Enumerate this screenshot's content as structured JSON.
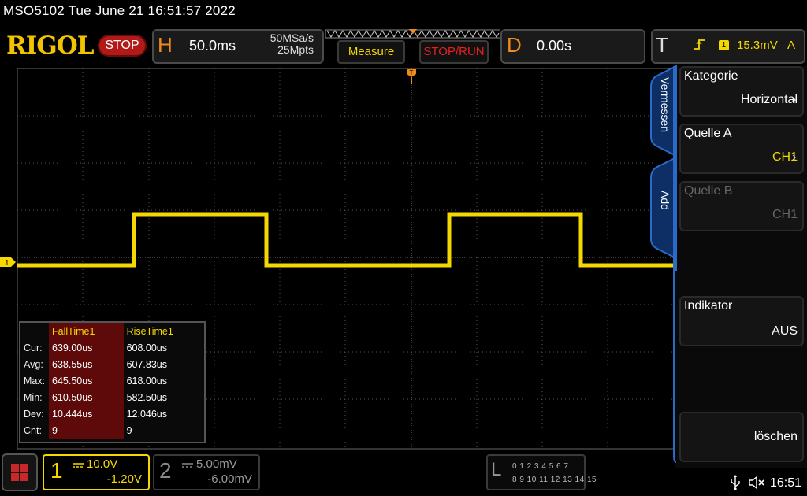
{
  "title": "MSO5102  Tue June 21 16:51:57 2022",
  "logo": "RIGOL",
  "status": "STOP",
  "horizontal": {
    "letter": "H",
    "timebase": "50.0ms",
    "sample_rate": "50MSa/s",
    "memory_depth": "25Mpts"
  },
  "buttons": {
    "measure": "Measure",
    "stop_run": "STOP/RUN"
  },
  "delay": {
    "letter": "D",
    "value": "0.00s"
  },
  "trigger": {
    "letter": "T",
    "source_num": "1",
    "level": "15.3mV",
    "mode": "A"
  },
  "side_tabs": {
    "measure": "Vermessen",
    "add": "Add"
  },
  "side_menu": {
    "category": {
      "label": "Kategorie",
      "value": "Horizontal"
    },
    "source_a": {
      "label": "Quelle A",
      "value": "CH1"
    },
    "source_b": {
      "label": "Quelle B",
      "value": "CH1"
    },
    "indicator": {
      "label": "Indikator",
      "value": "AUS"
    },
    "clear": {
      "label": "löschen"
    }
  },
  "measurements": {
    "headers": [
      "FallTime1",
      "RiseTime1"
    ],
    "rows": [
      {
        "label": "Cur:",
        "fall": "639.00us",
        "rise": "608.00us"
      },
      {
        "label": "Avg:",
        "fall": "638.55us",
        "rise": "607.83us"
      },
      {
        "label": "Max:",
        "fall": "645.50us",
        "rise": "618.00us"
      },
      {
        "label": "Min:",
        "fall": "610.50us",
        "rise": "582.50us"
      },
      {
        "label": "Dev:",
        "fall": "10.444us",
        "rise": "12.046us"
      },
      {
        "label": "Cnt:",
        "fall": "9",
        "rise": "9"
      }
    ]
  },
  "channel1": {
    "number": "1",
    "scale": "10.0V",
    "offset": "-1.20V",
    "marker": "1",
    "color": "#f5d800"
  },
  "channel2": {
    "number": "2",
    "scale": "5.00mV",
    "offset": "-6.00mV"
  },
  "logic_analyzer": {
    "letter": "L",
    "row1": "0 1 2 3  4 5 6 7",
    "row2": "8 9 10 11 12 13 14 15"
  },
  "clock": "16:51",
  "colors": {
    "accent": "#f08a1a",
    "trace": "#f5d800",
    "stop": "#b21a1a",
    "panel_border": "#1e5aa8"
  }
}
